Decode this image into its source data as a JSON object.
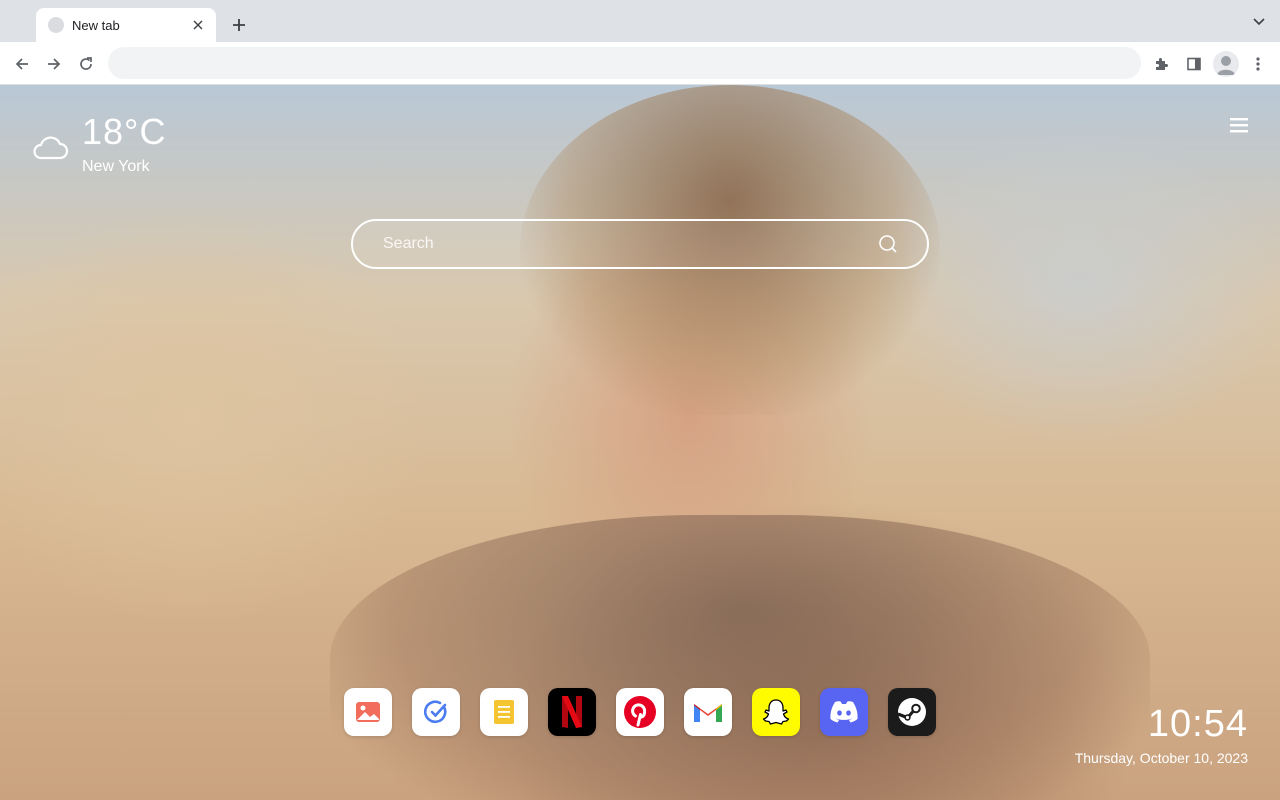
{
  "browser": {
    "tab": {
      "title": "New tab"
    },
    "omnibox": {
      "value": ""
    }
  },
  "weather": {
    "temperature": "18°C",
    "city": "New York",
    "icon": "cloud-icon"
  },
  "search": {
    "placeholder": "Search"
  },
  "dock": {
    "apps": [
      {
        "name": "photos",
        "icon": "image-icon",
        "bg": "#ffffff"
      },
      {
        "name": "todo",
        "icon": "check-circle-icon",
        "bg": "#ffffff"
      },
      {
        "name": "notes",
        "icon": "notes-icon",
        "bg": "#ffffff"
      },
      {
        "name": "netflix",
        "icon": "netflix-icon",
        "bg": "#000000",
        "label": "N"
      },
      {
        "name": "pinterest",
        "icon": "pinterest-icon",
        "bg": "#ffffff",
        "label": "P"
      },
      {
        "name": "gmail",
        "icon": "gmail-icon",
        "bg": "#ffffff",
        "label": "M"
      },
      {
        "name": "snapchat",
        "icon": "snapchat-icon",
        "bg": "#fffc00"
      },
      {
        "name": "discord",
        "icon": "discord-icon",
        "bg": "#5865f2"
      },
      {
        "name": "steam",
        "icon": "steam-icon",
        "bg": "#1b1b1b"
      }
    ]
  },
  "clock": {
    "time": "10:54",
    "date": "Thursday, October 10, 2023"
  },
  "colors": {
    "accent_red": "#e50914",
    "pinterest_red": "#e60023",
    "discord": "#5865f2",
    "snapchat": "#fffc00"
  }
}
